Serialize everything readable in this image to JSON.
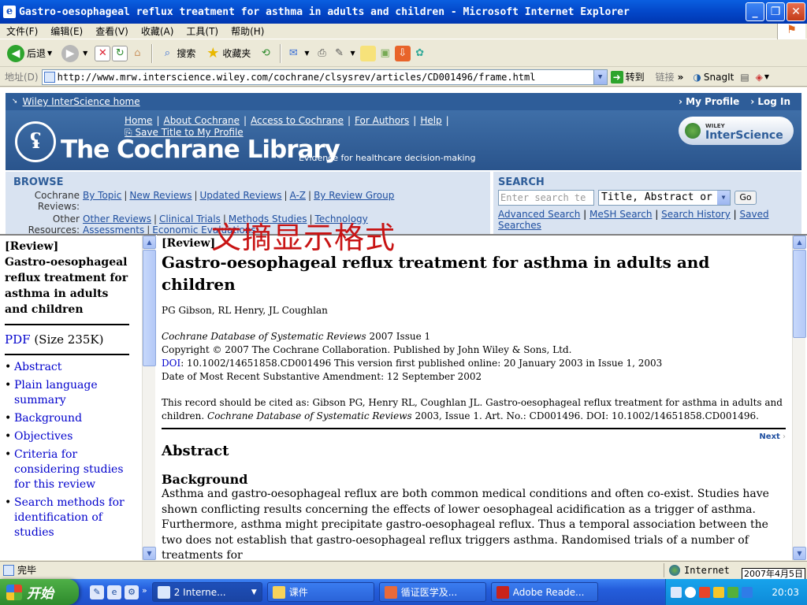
{
  "window": {
    "title": "Gastro-oesophageal reflux treatment for asthma in adults and children - Microsoft Internet Explorer"
  },
  "menu": [
    "文件(F)",
    "编辑(E)",
    "查看(V)",
    "收藏(A)",
    "工具(T)",
    "帮助(H)"
  ],
  "toolbar": {
    "back": "后退",
    "search": "搜索",
    "favorites": "收藏夹"
  },
  "address": {
    "label": "地址(D)",
    "url": "http://www.mrw.interscience.wiley.com/cochrane/clsysrev/articles/CD001496/frame.html",
    "go": "转到",
    "links": "链接",
    "snagit": "SnagIt"
  },
  "header": {
    "home_link": "Wiley InterScience home",
    "my_profile": "My Profile",
    "log_in": "Log In",
    "nav": [
      "Home",
      "About Cochrane",
      "Access to Cochrane",
      "For Authors",
      "Help"
    ],
    "save_title": "Save Title to My Profile",
    "library_title": "The Cochrane Library",
    "tagline": "Evidence for healthcare decision-making",
    "wiley_small": "WILEY",
    "wiley_brand": "InterScience"
  },
  "browse": {
    "heading": "BROWSE",
    "reviews_label": "Cochrane Reviews:",
    "reviews_links": [
      "By Topic",
      "New Reviews",
      "Updated Reviews",
      "A-Z",
      "By Review Group"
    ],
    "resources_label": "Other Resources:",
    "resources_links": [
      "Other Reviews",
      "Clinical Trials",
      "Methods Studies",
      "Technology Assessments",
      "Economic Evaluations"
    ]
  },
  "search": {
    "heading": "SEARCH",
    "placeholder": "Enter search te",
    "scope": "Title, Abstract or",
    "go": "Go",
    "links": [
      "Advanced Search",
      "MeSH Search",
      "Search History",
      "Saved Searches"
    ]
  },
  "overlay_text": "文摘显示格式",
  "sidebar": {
    "review_tag": "[Review]",
    "title": "Gastro-oesophageal reflux treatment for asthma in adults and children",
    "pdf_link": "PDF",
    "pdf_size": "(Size 235K)",
    "items": [
      "Abstract",
      "Plain language summary",
      "Background",
      "Objectives",
      "Criteria for considering studies for this review",
      "Search methods for identification of studies"
    ]
  },
  "article": {
    "review_tag": "[Review]",
    "title": "Gastro-oesophageal reflux treatment for asthma in adults and children",
    "authors": "PG Gibson, RL Henry, JL Coughlan",
    "journal": "Cochrane Database of Systematic Reviews",
    "issue": " 2007 Issue 1",
    "copyright": "Copyright © 2007 The Cochrane Collaboration. Published by John Wiley & Sons, Ltd.",
    "doi_label": "DOI",
    "doi_text": ": 10.1002/14651858.CD001496   This version first published online: 20 January 2003 in Issue 1, 2003",
    "amendment": "Date of Most Recent Substantive Amendment: 12 September 2002",
    "cite_prefix": "This record should be cited as: Gibson PG, Henry RL, Coughlan JL. Gastro-oesophageal reflux treatment for asthma in adults and children. ",
    "cite_journal": "Cochrane Database of Systematic Reviews",
    "cite_suffix": " 2003, Issue 1. Art. No.: CD001496. DOI: 10.1002/14651858.CD001496.",
    "next": "Next",
    "abstract_heading": "Abstract",
    "background_heading": "Background",
    "background_text": "Asthma and gastro-oesophageal reflux are both common medical conditions and often co-exist. Studies have shown conflicting results concerning the effects of lower oesophageal acidification as a trigger of asthma. Furthermore, asthma might precipitate gastro-oesophageal reflux. Thus a temporal association between the two does not establish that gastro-oesophageal reflux triggers asthma. Randomised trials of a number of treatments for"
  },
  "status": {
    "text": "完毕",
    "zone": "Internet",
    "date": "2007年4月5日"
  },
  "taskbar": {
    "start": "开始",
    "tasks": [
      "2 Interne...",
      "课件",
      "循证医学及...",
      "Adobe Reade..."
    ],
    "clock": "20:03"
  }
}
